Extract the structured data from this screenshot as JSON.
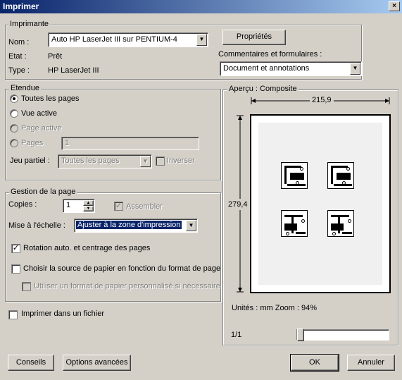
{
  "window": {
    "title": "Imprimer",
    "close_glyph": "×"
  },
  "imprimante": {
    "legend": "Imprimante",
    "nom_label": "Nom :",
    "nom_value": "Auto HP LaserJet III sur PENTIUM-4",
    "etat_label": "Etat :",
    "etat_value": "Prêt",
    "type_label": "Type :",
    "type_value": "HP LaserJet III",
    "proprietes_label": "Propriétés",
    "commentaires_label": "Commentaires et formulaires :",
    "commentaires_value": "Document et annotations"
  },
  "etendue": {
    "legend": "Etendue",
    "toutes_pages": "Toutes les pages",
    "vue_active": "Vue active",
    "page_active": "Page active",
    "pages": "Pages",
    "pages_value": "1",
    "jeu_partiel_label": "Jeu partiel :",
    "jeu_partiel_value": "Toutes les pages",
    "inverser": "Inverser"
  },
  "gestion": {
    "legend": "Gestion de la page",
    "copies_label": "Copies :",
    "copies_value": "1",
    "assembler": "Assembler",
    "echelle_label": "Mise à l'échelle :",
    "echelle_value": "Ajuster à la zone d'impression",
    "rotation": "Rotation auto. et centrage des pages",
    "source_papier": "Choisir la source de papier en fonction du format de page",
    "format_perso": "Utiliser un format de papier personnalisé si nécessaire"
  },
  "imprimer_fichier": "Imprimer dans un fichier",
  "apercu": {
    "legend": "Aperçu : Composite",
    "width": "215,9",
    "height": "279,4",
    "units": "Unités : mm Zoom :  94%",
    "page_count": "1/1"
  },
  "buttons": {
    "conseils": "Conseils",
    "options": "Options avancées",
    "ok": "OK",
    "annuler": "Annuler"
  },
  "glyphs": {
    "check": "✓",
    "arrow_down": "▼",
    "arrow_up_small": "▲",
    "arrow_down_small": "▼"
  }
}
